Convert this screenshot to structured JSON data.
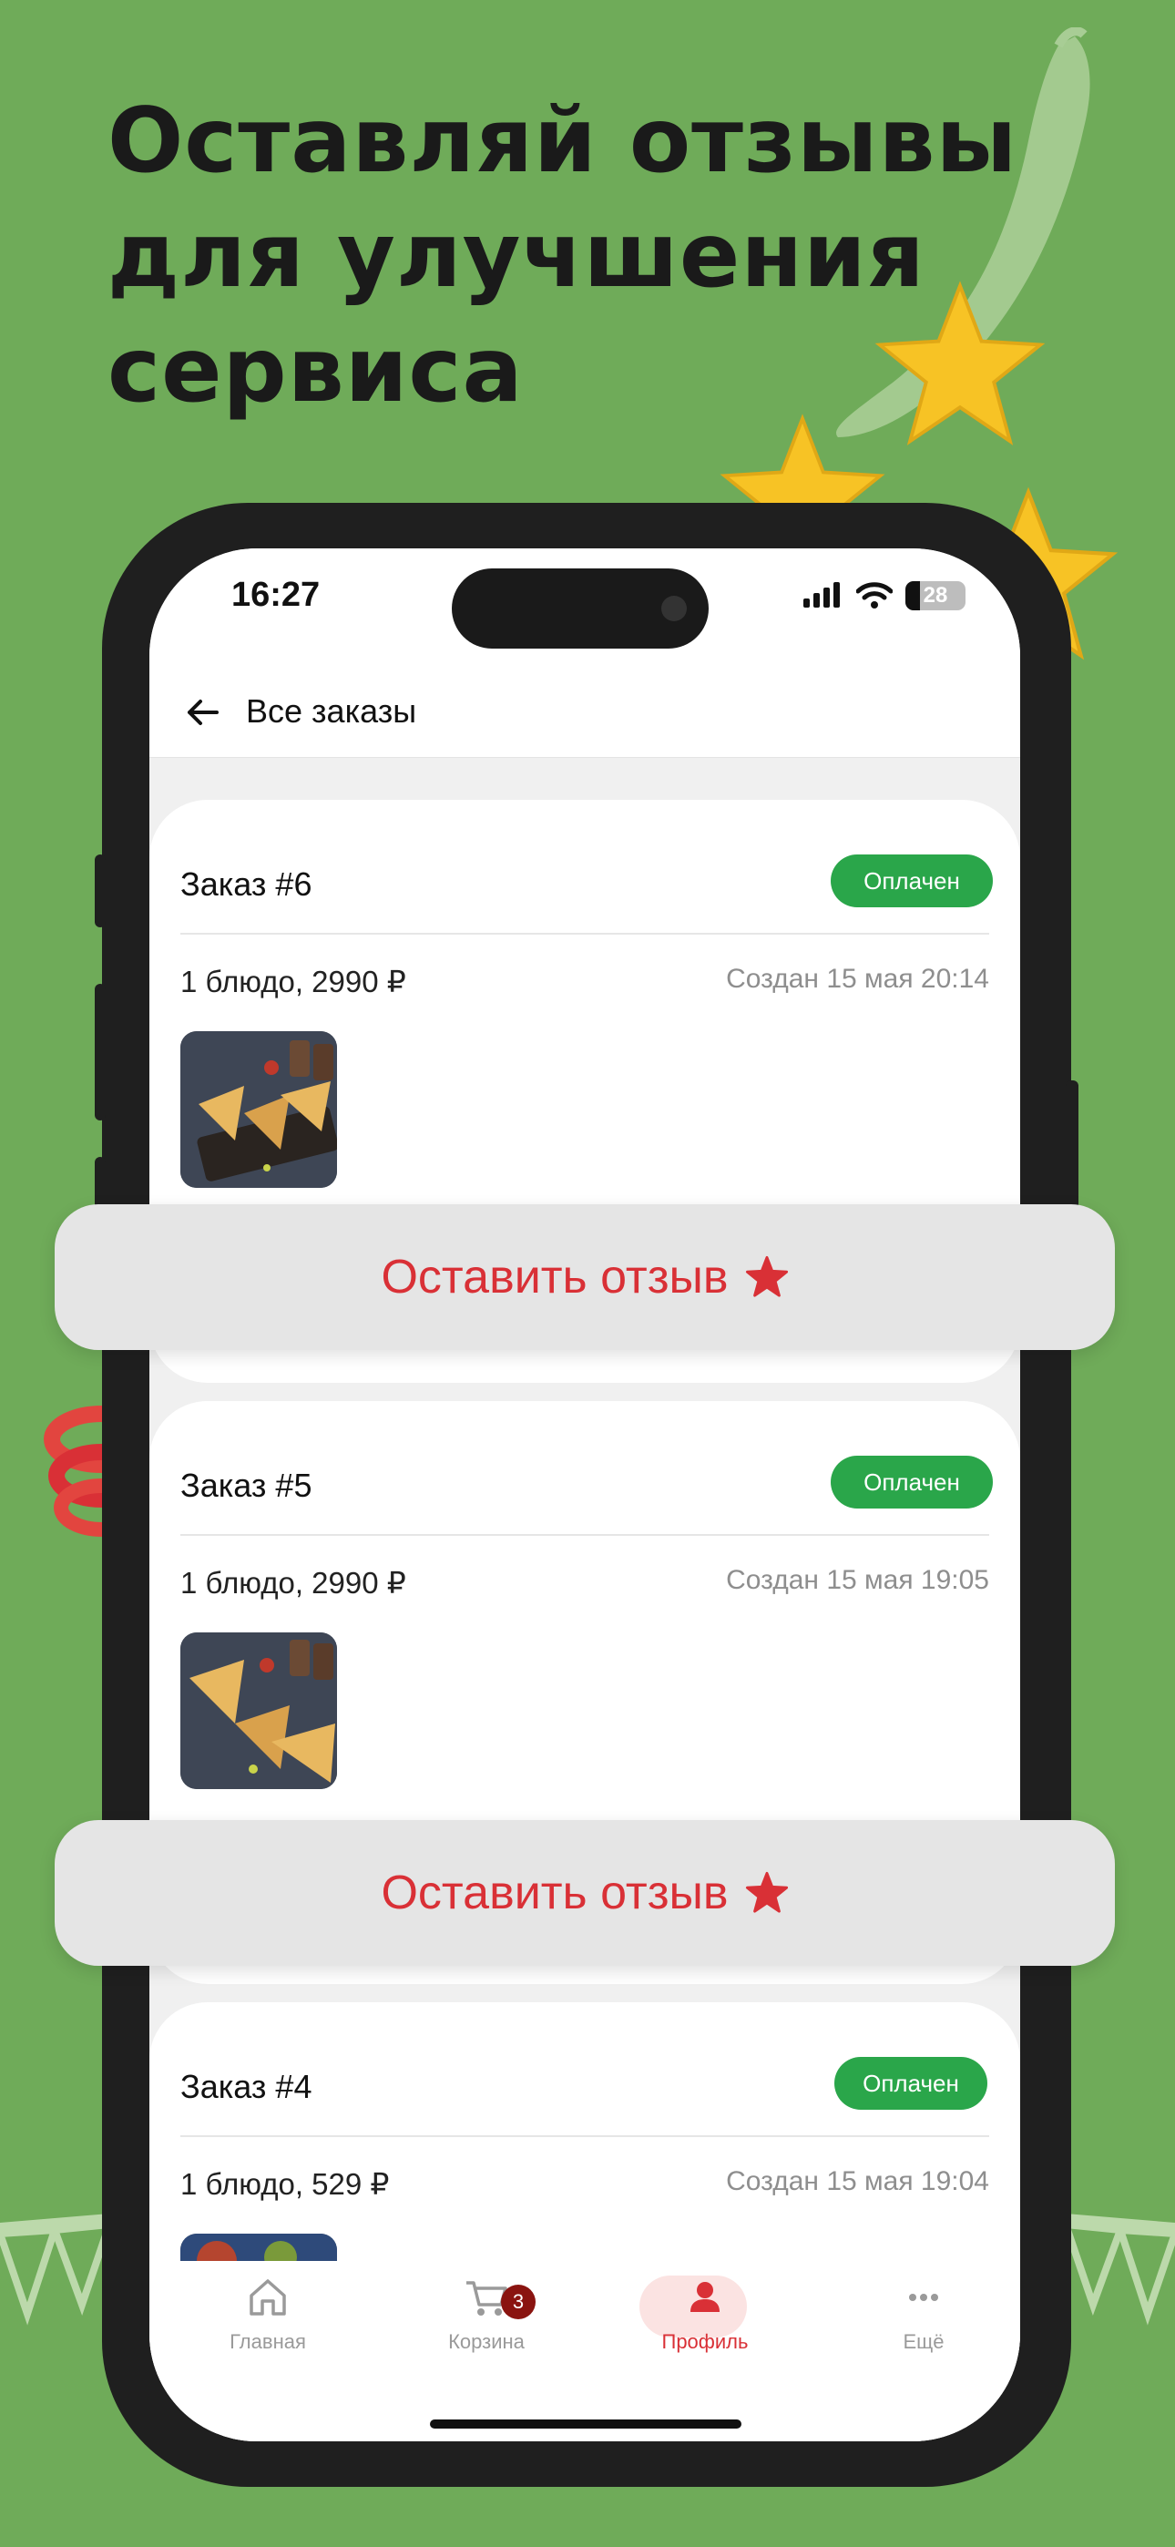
{
  "promo": {
    "headline_lines": [
      "Оставляй отзывы",
      "для улучшения",
      "сервиса"
    ]
  },
  "colors": {
    "background": "#6fab59",
    "accent_red": "#d93036",
    "status_green": "#2aa64a"
  },
  "status_bar": {
    "time": "16:27",
    "battery": "28",
    "icons": [
      "signal-icon",
      "wifi-icon",
      "battery-icon"
    ]
  },
  "nav": {
    "back_icon": "arrow-left-icon",
    "title": "Все заказы"
  },
  "orders": [
    {
      "title": "Заказ #6",
      "status": "Оплачен",
      "summary": "1 блюдо, 2990 ₽",
      "date": "Создан 15 мая 20:14"
    },
    {
      "title": "Заказ #5",
      "status": "Оплачен",
      "summary": "1 блюдо, 2990 ₽",
      "date": "Создан 15 мая 19:05"
    },
    {
      "title": "Заказ #4",
      "status": "Оплачен",
      "summary": "1 блюдо, 529 ₽",
      "date": "Создан 15 мая 19:04"
    }
  ],
  "review_button": {
    "label": "Оставить отзыв",
    "icon": "star-icon"
  },
  "tab_bar": {
    "tabs": [
      {
        "label": "Главная",
        "icon": "home-icon"
      },
      {
        "label": "Корзина",
        "icon": "cart-icon",
        "badge": "3"
      },
      {
        "label": "Профиль",
        "icon": "profile-icon",
        "active": true
      },
      {
        "label": "Ещё",
        "icon": "more-icon"
      }
    ]
  }
}
